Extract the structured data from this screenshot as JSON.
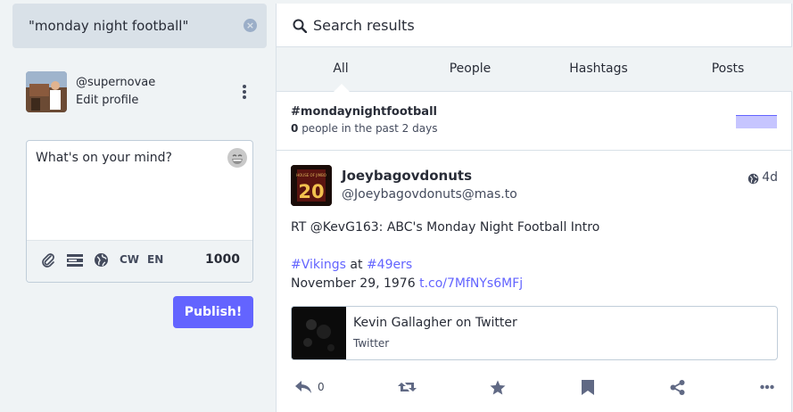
{
  "search": {
    "query": "\"monday night football\""
  },
  "profile": {
    "handle": "@supernovae",
    "edit_label": "Edit profile"
  },
  "compose": {
    "placeholder": "What's on your mind?",
    "cw_label": "CW",
    "lang_label": "EN",
    "char_count": "1000",
    "publish_label": "Publish!"
  },
  "results": {
    "title": "Search results",
    "tabs": [
      {
        "label": "All",
        "active": true
      },
      {
        "label": "People",
        "active": false
      },
      {
        "label": "Hashtags",
        "active": false
      },
      {
        "label": "Posts",
        "active": false
      }
    ],
    "hashtag": {
      "name": "#mondaynightfootball",
      "usage_count": "0",
      "usage_text": "people in the past 2 days"
    }
  },
  "status": {
    "display_name": "Joeybagovdonuts",
    "acct": "@Joeybagovdonuts@mas.to",
    "time": "4d",
    "avatar_number": "20",
    "line1": "RT @KevG163: ABC's Monday Night Football Intro",
    "tag1": "#Vikings",
    "at_word": "at",
    "tag2": "#49ers",
    "date_text": "November 29, 1976",
    "link": "t.co/7MfNYs6MFj",
    "card": {
      "title": "Kevin Gallagher on Twitter",
      "provider": "Twitter"
    },
    "reply_count": "0"
  },
  "colors": {
    "accent": "#6364ff",
    "background": "#eff3f5",
    "search_bg": "#d9e1e8"
  },
  "icons": [
    "clear-icon",
    "kebab-menu-icon",
    "emoji-icon",
    "paperclip-icon",
    "poll-icon",
    "globe-icon",
    "search-icon",
    "reply-icon",
    "boost-icon",
    "star-icon",
    "bookmark-icon",
    "share-icon",
    "more-icon"
  ]
}
